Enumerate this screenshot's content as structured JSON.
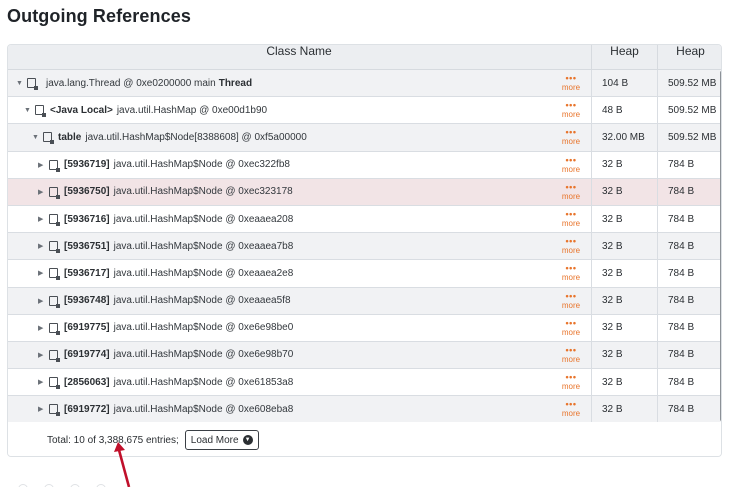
{
  "page": {
    "heading": "Outgoing References"
  },
  "table": {
    "columns": [
      "Class Name",
      "Heap",
      "Heap"
    ],
    "more_label": "more",
    "rows": [
      {
        "bold": "",
        "text": "java.lang.Thread @ 0xe0200000 main",
        "suffix": "Thread",
        "heap": "104 B",
        "retained": "509.52 MB",
        "expanded": true
      },
      {
        "bold": "<Java Local>",
        "text": "java.util.HashMap @ 0xe00d1b90",
        "suffix": "",
        "heap": "48 B",
        "retained": "509.52 MB",
        "expanded": true
      },
      {
        "bold": "table",
        "text": "java.util.HashMap$Node[8388608] @ 0xf5a00000",
        "suffix": "",
        "heap": "32.00 MB",
        "retained": "509.52 MB",
        "expanded": true
      },
      {
        "bold": "[5936719]",
        "text": "java.util.HashMap$Node @ 0xec322fb8",
        "suffix": "",
        "heap": "32 B",
        "retained": "784 B",
        "expanded": false
      },
      {
        "bold": "[5936750]",
        "text": "java.util.HashMap$Node @ 0xec323178",
        "suffix": "",
        "heap": "32 B",
        "retained": "784 B",
        "expanded": false,
        "selected": true
      },
      {
        "bold": "[5936716]",
        "text": "java.util.HashMap$Node @ 0xeaaea208",
        "suffix": "",
        "heap": "32 B",
        "retained": "784 B",
        "expanded": false
      },
      {
        "bold": "[5936751]",
        "text": "java.util.HashMap$Node @ 0xeaaea7b8",
        "suffix": "",
        "heap": "32 B",
        "retained": "784 B",
        "expanded": false
      },
      {
        "bold": "[5936717]",
        "text": "java.util.HashMap$Node @ 0xeaaea2e8",
        "suffix": "",
        "heap": "32 B",
        "retained": "784 B",
        "expanded": false
      },
      {
        "bold": "[5936748]",
        "text": "java.util.HashMap$Node @ 0xeaaea5f8",
        "suffix": "",
        "heap": "32 B",
        "retained": "784 B",
        "expanded": false
      },
      {
        "bold": "[6919775]",
        "text": "java.util.HashMap$Node @ 0xe6e98be0",
        "suffix": "",
        "heap": "32 B",
        "retained": "784 B",
        "expanded": false
      },
      {
        "bold": "[6919774]",
        "text": "java.util.HashMap$Node @ 0xe6e98b70",
        "suffix": "",
        "heap": "32 B",
        "retained": "784 B",
        "expanded": false
      },
      {
        "bold": "[2856063]",
        "text": "java.util.HashMap$Node @ 0xe61853a8",
        "suffix": "",
        "heap": "32 B",
        "retained": "784 B",
        "expanded": false
      },
      {
        "bold": "[6919772]",
        "text": "java.util.HashMap$Node @ 0xe608eba8",
        "suffix": "",
        "heap": "32 B",
        "retained": "784 B",
        "expanded": false
      }
    ],
    "footer": {
      "total_text": "Total: 10 of 3,388,675 entries;",
      "load_more_label": "Load More"
    }
  },
  "colors": {
    "accent_more": "#e8742b",
    "selected_row": "#f2e4e6",
    "annotation_arrow": "#c0102b"
  }
}
